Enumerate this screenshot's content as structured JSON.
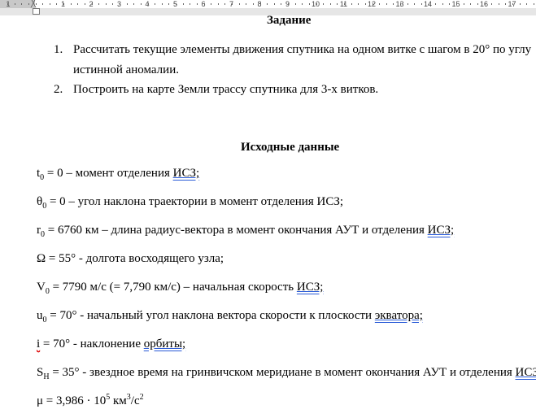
{
  "ruler": {
    "left": [
      "1"
    ],
    "marks": [
      "1",
      "2",
      "3",
      "4",
      "5",
      "6",
      "7",
      "8",
      "9",
      "10",
      "11",
      "12",
      "13",
      "14",
      "15",
      "16",
      "17"
    ]
  },
  "task": {
    "title": "Задание",
    "items": [
      {
        "num": "1.",
        "line1": "Рассчитать текущие элементы движения спутника на одном витке с шагом в 20° по углу",
        "line2": "истинной аномалии."
      },
      {
        "num": "2.",
        "line1": "Построить на карте Земли трассу спутника для 3-х витков."
      }
    ]
  },
  "initial": {
    "title": "Исходные данные",
    "t0": {
      "sym": "t",
      "sub": "0",
      "text": " = 0 – момент отделения ",
      "link": "ИСЗ;"
    },
    "theta0": {
      "sym": "θ",
      "sub": "0",
      "text": " = 0 – угол наклона траектории в момент отделения ИСЗ;"
    },
    "r0": {
      "sym": "r",
      "sub": "0",
      "text": " = 6760 км – длина радиус-вектора в момент окончания АУТ и отделения ",
      "link": "ИСЗ;"
    },
    "omega": {
      "text": "Ω = 55° - долгота восходящего узла;"
    },
    "v0": {
      "sym": "V",
      "sub": "0",
      "text": " = 7790 м/с (= 7,790 км/с) – начальная скорость ",
      "link": "ИСЗ;"
    },
    "u0": {
      "sym": "u",
      "sub": "0",
      "text": " = 70° - начальный угол наклона вектора скорости к плоскости ",
      "link": "экватора;"
    },
    "i": {
      "sym": "i",
      "text": " = 70° - наклонение ",
      "link": "орбиты;"
    },
    "sh": {
      "sym": "S",
      "sub": "H",
      "text": " = 35° - звездное время на гринвичском меридиане в момент окончания АУТ и отделения ",
      "link": "ИСЗ;"
    },
    "mu": {
      "text": "μ = 3,986 · 10",
      "exp": "5",
      "unit": " км",
      "unit_exp": "3",
      "unit2": "/с",
      "unit2_exp": "2"
    }
  }
}
